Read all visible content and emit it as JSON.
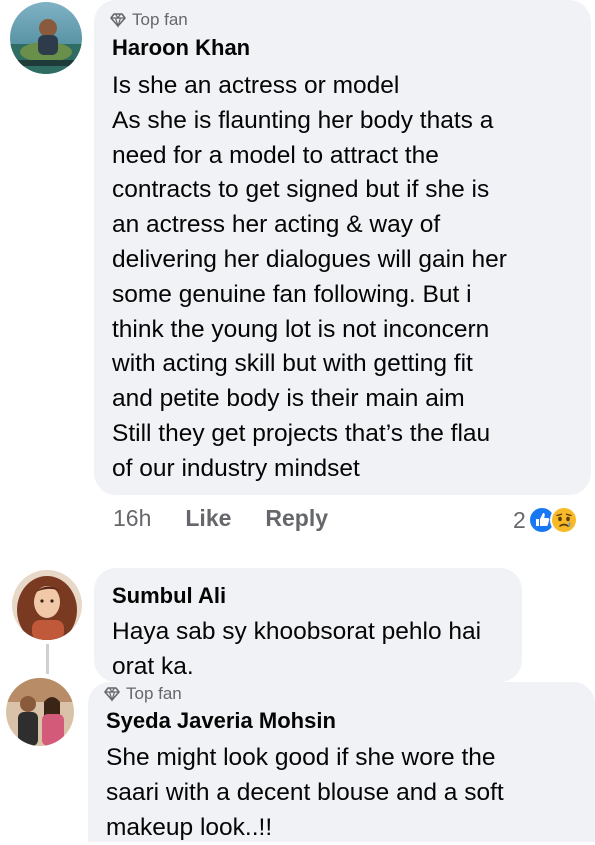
{
  "comments": [
    {
      "badge": "Top fan",
      "author": "Haroon Khan",
      "lines": [
        "Is she an actress or model",
        "As she is flaunting her body thats a",
        "need for a model to attract the",
        "contracts to get signed but if she is",
        "an actress her acting & way of",
        "delivering her dialogues will gain her",
        "some genuine fan following. But i",
        "think the young lot is not inconcern",
        "with acting skill but with getting fit",
        "and petite body is their main aim",
        "Still they get projects that’s the flau",
        "of our industry mindset"
      ],
      "time": "16h",
      "like": "Like",
      "reply": "Reply",
      "reaction_count": "2",
      "reaction_icons": [
        "like-icon",
        "sad-icon"
      ]
    },
    {
      "author": "Sumbul Ali",
      "lines": [
        "Haya sab sy khoobsorat pehlo hai",
        "orat ka."
      ]
    },
    {
      "badge": "Top fan",
      "author": "Syeda Javeria Mohsin",
      "lines": [
        "She might look good if she wore the",
        "saari with a decent blouse and a soft",
        "makeup look..!!"
      ]
    }
  ],
  "colors": {
    "bubble": "#f0f2f5",
    "secondary_text": "#65676b",
    "like_blue": "#1877f2",
    "sad_yellow": "#f7b928"
  }
}
